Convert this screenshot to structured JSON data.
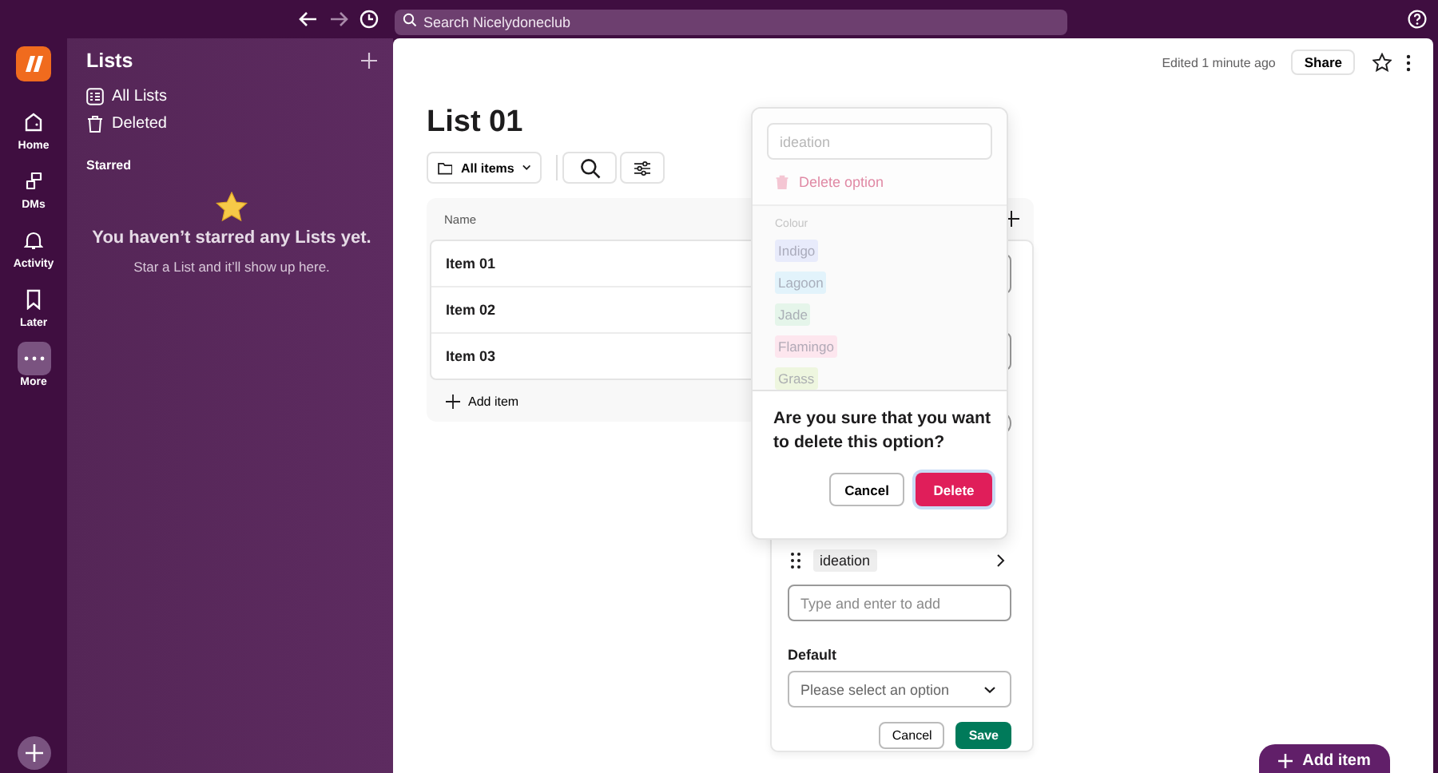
{
  "topbar": {
    "search_placeholder": "Search Nicelydoneclub"
  },
  "rail": {
    "items": [
      {
        "label": "Home",
        "selected": false
      },
      {
        "label": "DMs",
        "selected": false
      },
      {
        "label": "Activity",
        "selected": false
      },
      {
        "label": "Later",
        "selected": false
      },
      {
        "label": "More",
        "selected": true
      }
    ]
  },
  "sidebar": {
    "title": "Lists",
    "links": [
      "All Lists",
      "Deleted"
    ],
    "section": "Starred",
    "empty_title": "You haven’t starred any Lists yet.",
    "empty_text": "Star a List and it’ll show up here."
  },
  "header": {
    "edited": "Edited 1 minute ago",
    "share": "Share"
  },
  "list": {
    "title": "List 01",
    "filter": "All items",
    "columns": [
      "Name"
    ],
    "rows": [
      {
        "name": "Item 01"
      },
      {
        "name": "Item 02"
      },
      {
        "name": "Item 03"
      }
    ],
    "add_item": "Add item"
  },
  "field_editor": {
    "option_chip": "ideation",
    "new_option_placeholder": "Type and enter to add",
    "default_label": "Default",
    "default_placeholder": "Please select an option",
    "cancel": "Cancel",
    "save": "Save"
  },
  "option_popover": {
    "name_value": "ideation",
    "delete_option": "Delete option",
    "colour_label": "Colour",
    "colours": [
      {
        "name": "Indigo",
        "color": "#e8ebfb"
      },
      {
        "name": "Lagoon",
        "color": "#e2f3fb"
      },
      {
        "name": "Jade",
        "color": "#e5f5ea"
      },
      {
        "name": "Flamingo",
        "color": "#fde6ee"
      },
      {
        "name": "Grass",
        "color": "#eef6df"
      }
    ],
    "confirm_text": "Are you sure that you want to delete this option?",
    "cancel": "Cancel",
    "delete": "Delete"
  },
  "fab": {
    "label": "Add item"
  }
}
